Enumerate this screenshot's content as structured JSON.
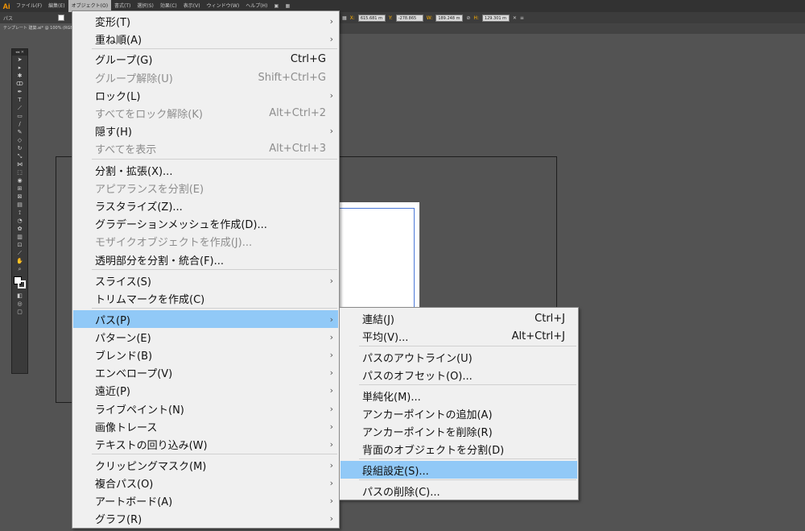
{
  "app": {
    "logo": "Ai",
    "menubar": [
      "ファイル(F)",
      "編集(E)",
      "オブジェクト(O)",
      "書式(T)",
      "選択(S)",
      "効果(C)",
      "表示(V)",
      "ウィンドウ(W)",
      "ヘルプ(H)"
    ],
    "active_menu": "オブジェクト(O)"
  },
  "controlbar": {
    "selection_label": "パス",
    "x_label": "X:",
    "x_value": "615.681 m",
    "y_label": "Y:",
    "y_value": "-278.865",
    "w_label": "W:",
    "w_value": "189.248 m",
    "h_label": "H:",
    "h_value": "129.301 m"
  },
  "document": {
    "tab_title": "テンプレート 建築.ai* @ 100% (RGB"
  },
  "object_menu": {
    "items": [
      {
        "label": "変形(T)",
        "shortcut": "",
        "submenu": true,
        "disabled": false
      },
      {
        "label": "重ね順(A)",
        "shortcut": "",
        "submenu": true,
        "disabled": false
      },
      {
        "label": "グループ(G)",
        "shortcut": "Ctrl+G",
        "submenu": false,
        "disabled": false
      },
      {
        "label": "グループ解除(U)",
        "shortcut": "Shift+Ctrl+G",
        "submenu": false,
        "disabled": true
      },
      {
        "label": "ロック(L)",
        "shortcut": "",
        "submenu": true,
        "disabled": false
      },
      {
        "label": "すべてをロック解除(K)",
        "shortcut": "Alt+Ctrl+2",
        "submenu": false,
        "disabled": true
      },
      {
        "label": "隠す(H)",
        "shortcut": "",
        "submenu": true,
        "disabled": false
      },
      {
        "label": "すべてを表示",
        "shortcut": "Alt+Ctrl+3",
        "submenu": false,
        "disabled": true
      },
      {
        "label": "分割・拡張(X)...",
        "shortcut": "",
        "submenu": false,
        "disabled": false
      },
      {
        "label": "アピアランスを分割(E)",
        "shortcut": "",
        "submenu": false,
        "disabled": true
      },
      {
        "label": "ラスタライズ(Z)...",
        "shortcut": "",
        "submenu": false,
        "disabled": false
      },
      {
        "label": "グラデーションメッシュを作成(D)...",
        "shortcut": "",
        "submenu": false,
        "disabled": false
      },
      {
        "label": "モザイクオブジェクトを作成(J)...",
        "shortcut": "",
        "submenu": false,
        "disabled": true
      },
      {
        "label": "透明部分を分割・統合(F)...",
        "shortcut": "",
        "submenu": false,
        "disabled": false
      },
      {
        "label": "スライス(S)",
        "shortcut": "",
        "submenu": true,
        "disabled": false
      },
      {
        "label": "トリムマークを作成(C)",
        "shortcut": "",
        "submenu": false,
        "disabled": false
      },
      {
        "label": "パス(P)",
        "shortcut": "",
        "submenu": true,
        "disabled": false,
        "highlight": true
      },
      {
        "label": "パターン(E)",
        "shortcut": "",
        "submenu": true,
        "disabled": false
      },
      {
        "label": "ブレンド(B)",
        "shortcut": "",
        "submenu": true,
        "disabled": false
      },
      {
        "label": "エンベロープ(V)",
        "shortcut": "",
        "submenu": true,
        "disabled": false
      },
      {
        "label": "遠近(P)",
        "shortcut": "",
        "submenu": true,
        "disabled": false
      },
      {
        "label": "ライブペイント(N)",
        "shortcut": "",
        "submenu": true,
        "disabled": false
      },
      {
        "label": "画像トレース",
        "shortcut": "",
        "submenu": true,
        "disabled": false
      },
      {
        "label": "テキストの回り込み(W)",
        "shortcut": "",
        "submenu": true,
        "disabled": false
      },
      {
        "label": "クリッピングマスク(M)",
        "shortcut": "",
        "submenu": true,
        "disabled": false
      },
      {
        "label": "複合パス(O)",
        "shortcut": "",
        "submenu": true,
        "disabled": false
      },
      {
        "label": "アートボード(A)",
        "shortcut": "",
        "submenu": true,
        "disabled": false
      },
      {
        "label": "グラフ(R)",
        "shortcut": "",
        "submenu": true,
        "disabled": false
      }
    ]
  },
  "path_submenu": {
    "items": [
      {
        "label": "連結(J)",
        "shortcut": "Ctrl+J"
      },
      {
        "label": "平均(V)...",
        "shortcut": "Alt+Ctrl+J"
      },
      {
        "label": "パスのアウトライン(U)",
        "shortcut": ""
      },
      {
        "label": "パスのオフセット(O)...",
        "shortcut": ""
      },
      {
        "label": "単純化(M)...",
        "shortcut": ""
      },
      {
        "label": "アンカーポイントの追加(A)",
        "shortcut": ""
      },
      {
        "label": "アンカーポイントを削除(R)",
        "shortcut": ""
      },
      {
        "label": "背面のオブジェクトを分割(D)",
        "shortcut": ""
      },
      {
        "label": "段組設定(S)...",
        "shortcut": "",
        "highlight": true
      },
      {
        "label": "パスの削除(C)...",
        "shortcut": ""
      }
    ]
  }
}
